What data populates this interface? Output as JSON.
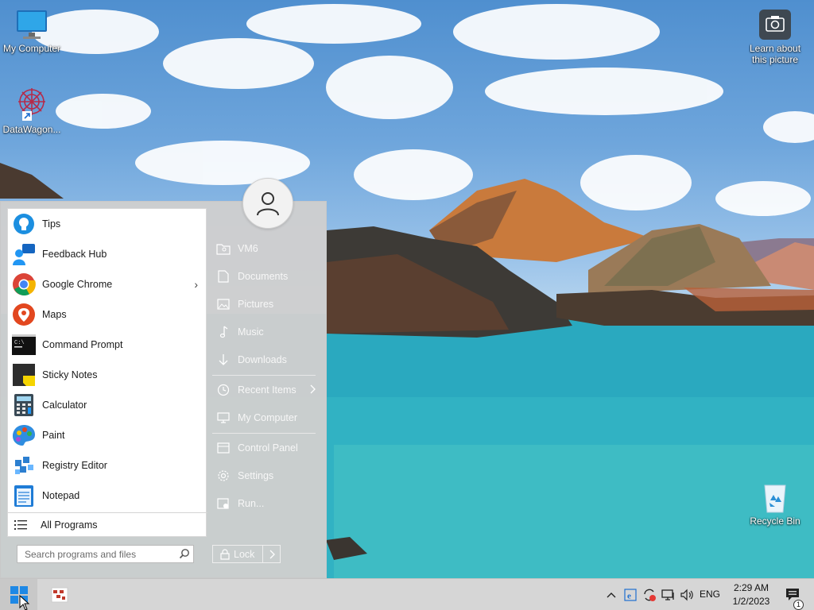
{
  "desktop": {
    "icons": [
      {
        "label": "My Computer",
        "icon": "monitor-icon"
      },
      {
        "label": "DataWagon...",
        "icon": "datawagon-shortcut-icon"
      },
      {
        "label": "Learn about this picture",
        "icon": "camera-icon"
      },
      {
        "label": "Recycle Bin",
        "icon": "recycle-bin-icon"
      }
    ]
  },
  "start_menu": {
    "apps": [
      {
        "label": "Tips",
        "icon": "lightbulb-icon"
      },
      {
        "label": "Feedback Hub",
        "icon": "feedback-hub-icon"
      },
      {
        "label": "Google Chrome",
        "icon": "chrome-icon",
        "has_submenu": true
      },
      {
        "label": "Maps",
        "icon": "map-pin-icon"
      },
      {
        "label": "Command Prompt",
        "icon": "cmd-icon"
      },
      {
        "label": "Sticky Notes",
        "icon": "sticky-notes-icon"
      },
      {
        "label": "Calculator",
        "icon": "calculator-icon"
      },
      {
        "label": "Paint",
        "icon": "paint-palette-icon"
      },
      {
        "label": "Registry Editor",
        "icon": "registry-icon"
      },
      {
        "label": "Notepad",
        "icon": "notepad-icon"
      }
    ],
    "all_programs": "All Programs",
    "search_placeholder": "Search programs and files",
    "right_items": [
      {
        "label": "VM6",
        "icon": "user-folder-icon"
      },
      {
        "label": "Documents",
        "icon": "document-icon"
      },
      {
        "label": "Pictures",
        "icon": "picture-icon"
      },
      {
        "label": "Music",
        "icon": "music-note-icon"
      },
      {
        "label": "Downloads",
        "icon": "download-arrow-icon"
      },
      {
        "label": "Recent Items",
        "icon": "clock-icon",
        "has_submenu": true
      },
      {
        "label": "My Computer",
        "icon": "computer-icon"
      },
      {
        "label": "Control Panel",
        "icon": "control-panel-icon"
      },
      {
        "label": "Settings",
        "icon": "gear-icon"
      },
      {
        "label": "Run...",
        "icon": "run-icon"
      }
    ],
    "lock_label": "Lock"
  },
  "taskbar": {
    "language": "ENG",
    "time": "2:29 AM",
    "date": "1/2/2023",
    "notification_count": "1"
  },
  "colors": {
    "start_menu_bg": "#cecece",
    "taskbar_bg": "#d6d6d6",
    "windows_blue": "#1e88e5"
  }
}
